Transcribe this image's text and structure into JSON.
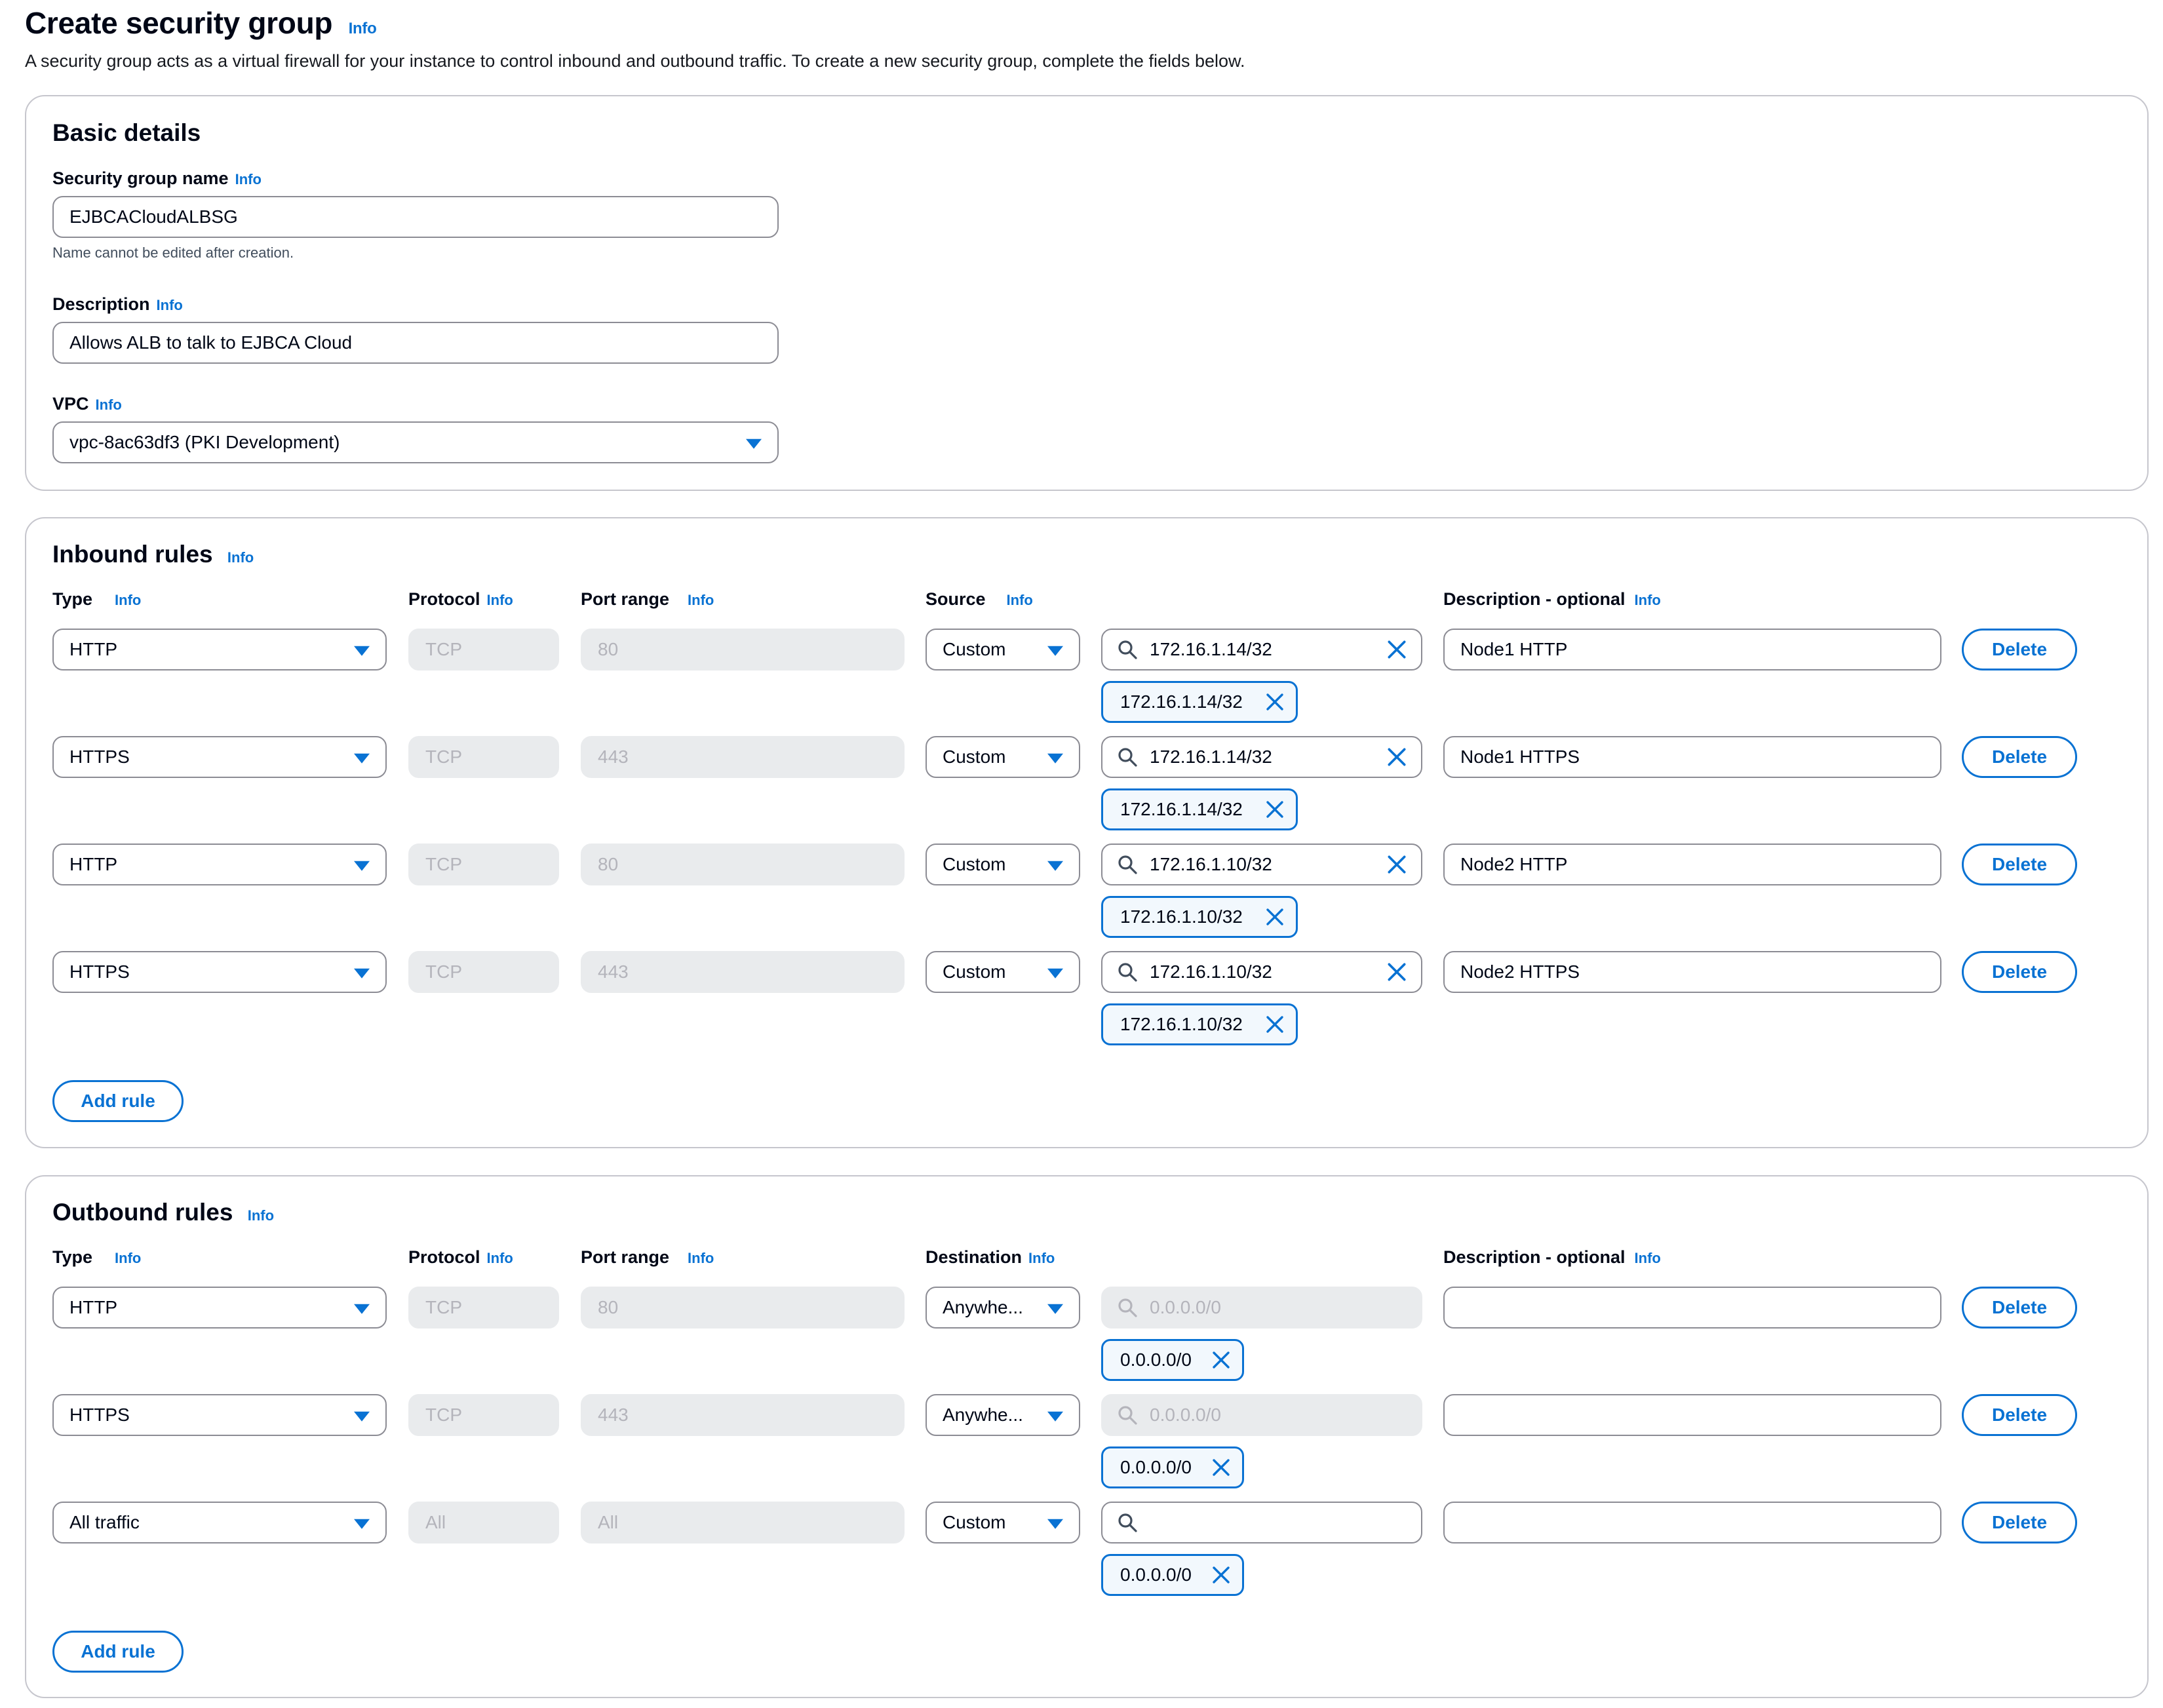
{
  "page": {
    "title": "Create security group",
    "info": "Info",
    "description": "A security group acts as a virtual firewall for your instance to control inbound and outbound traffic. To create a new security group, complete the fields below."
  },
  "basic": {
    "title": "Basic details",
    "name_label": "Security group name",
    "name_value": "EJBCACloudALBSG",
    "name_hint": "Name cannot be edited after creation.",
    "desc_label": "Description",
    "desc_value": "Allows ALB to talk to EJBCA Cloud",
    "vpc_label": "VPC",
    "vpc_value": "vpc-8ac63df3 (PKI Development)"
  },
  "inbound": {
    "title": "Inbound rules",
    "headers": {
      "type": "Type",
      "protocol": "Protocol",
      "port": "Port range",
      "source": "Source",
      "description": "Description - optional"
    },
    "rules": [
      {
        "type": "HTTP",
        "protocol": "TCP",
        "port": "80",
        "source": "Custom",
        "search": "172.16.1.14/32",
        "token": "172.16.1.14/32",
        "description": "Node1 HTTP"
      },
      {
        "type": "HTTPS",
        "protocol": "TCP",
        "port": "443",
        "source": "Custom",
        "search": "172.16.1.14/32",
        "token": "172.16.1.14/32",
        "description": "Node1 HTTPS"
      },
      {
        "type": "HTTP",
        "protocol": "TCP",
        "port": "80",
        "source": "Custom",
        "search": "172.16.1.10/32",
        "token": "172.16.1.10/32",
        "description": "Node2 HTTP"
      },
      {
        "type": "HTTPS",
        "protocol": "TCP",
        "port": "443",
        "source": "Custom",
        "search": "172.16.1.10/32",
        "token": "172.16.1.10/32",
        "description": "Node2 HTTPS"
      }
    ],
    "delete_label": "Delete",
    "add_label": "Add rule"
  },
  "outbound": {
    "title": "Outbound rules",
    "headers": {
      "type": "Type",
      "protocol": "Protocol",
      "port": "Port range",
      "destination": "Destination",
      "description": "Description - optional"
    },
    "rules": [
      {
        "type": "HTTP",
        "protocol": "TCP",
        "port": "80",
        "destination": "Anywhe...",
        "search_placeholder": "0.0.0.0/0",
        "token": "0.0.0.0/0",
        "description": ""
      },
      {
        "type": "HTTPS",
        "protocol": "TCP",
        "port": "443",
        "destination": "Anywhe...",
        "search_placeholder": "0.0.0.0/0",
        "token": "0.0.0.0/0",
        "description": ""
      },
      {
        "type": "All traffic",
        "protocol": "All",
        "port": "All",
        "destination": "Custom",
        "search_placeholder": "",
        "token": "0.0.0.0/0",
        "description": ""
      }
    ],
    "delete_label": "Delete",
    "add_label": "Add rule"
  },
  "colors": {
    "accent": "#0972d3",
    "border": "#8c8c94",
    "disabled_bg": "#e9ebed",
    "disabled_text": "#b4b4bb"
  }
}
